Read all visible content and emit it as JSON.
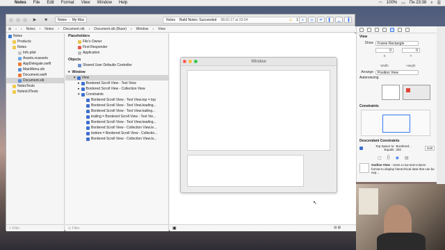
{
  "menubar": {
    "app": "Notes",
    "items": [
      "File",
      "Edit",
      "Format",
      "View",
      "Window",
      "Help"
    ],
    "clock": "Пн 23:38",
    "battery": "100%"
  },
  "toolbar": {
    "scheme_target": "Notes",
    "scheme_device": "My Mac",
    "status_app": "Notes",
    "status_text": "Build Notes: Succeeded",
    "status_time": "08.02.17 at 23:34",
    "warnings": "1"
  },
  "jumpbar": {
    "crumbs": [
      "Notes",
      "Notes",
      "Document.xib",
      "Document.xib (Base)",
      "Window",
      "View"
    ]
  },
  "navigator": {
    "items": [
      {
        "label": "Notes",
        "icon": "project-icon",
        "indent": 0
      },
      {
        "label": "Products",
        "icon": "folder-icon",
        "indent": 1
      },
      {
        "label": "Notes",
        "icon": "folder-icon",
        "indent": 1
      },
      {
        "label": "Info.plist",
        "icon": "file-icon",
        "indent": 2
      },
      {
        "label": "Assets.xcassets",
        "icon": "assets-icon",
        "indent": 2
      },
      {
        "label": "AppDelegate.swift",
        "icon": "swift-icon",
        "indent": 2
      },
      {
        "label": "MainMenu.xib",
        "icon": "xib-icon",
        "indent": 2
      },
      {
        "label": "Document.swift",
        "icon": "swift-icon",
        "indent": 2
      },
      {
        "label": "Document.xib",
        "icon": "xib-icon",
        "indent": 2
      },
      {
        "label": "NotesTests",
        "icon": "folder-icon",
        "indent": 1
      },
      {
        "label": "NotesUITests",
        "icon": "folder-icon",
        "indent": 1
      }
    ],
    "selected_index": 8,
    "filter_placeholder": "Filter"
  },
  "outline": {
    "placeholders_header": "Placeholders",
    "placeholders": [
      "File's Owner",
      "First Responder",
      "Application"
    ],
    "objects_header": "Objects",
    "objects": [
      "Shared User Defaults Controller"
    ],
    "window_header": "Window",
    "view_label": "View",
    "view_children": [
      "Bordered Scroll View - Text View",
      "Bordered Scroll View - Collection View"
    ],
    "constraints_label": "Constraints",
    "constraints": [
      "Bordered Scroll View - Text View.top = top",
      "Bordered Scroll View - Text View.leading...",
      "Bordered Scroll View - Text View.trailing...",
      "trailing = Bordered Scroll View - Text Vie...",
      "Bordered Scroll View - Text View.leading...",
      "Bordered Scroll View - Collection View.le...",
      "bottom = Bordered Scroll View - Collectio...",
      "Bordered Scroll View - Collection View.to..."
    ],
    "filter_placeholder": "Filter"
  },
  "canvas": {
    "window_title": "Window"
  },
  "inspector": {
    "section_view": "View",
    "show_label": "Show",
    "show_value": "Frame Rectangle",
    "x_value": "0",
    "y_value": "0",
    "x_label": "X",
    "y_label": "Y",
    "width_label": "Width",
    "height_label": "Height",
    "arrange_label": "Arrange",
    "arrange_value": "Position View",
    "autoresizing_label": "Autoresizing",
    "constraints_header": "Constraints",
    "descendant_header": "Descendant Constraints",
    "desc_row_label": "Top Space to:",
    "desc_row_target": "Bordered...",
    "desc_row_equals": "Equals:",
    "desc_row_value": "292",
    "desc_row_edit": "Edit"
  },
  "library": {
    "title": "Outline View",
    "description": "- Uses a row-and-column format to display hierarchical data that can be exp..."
  }
}
